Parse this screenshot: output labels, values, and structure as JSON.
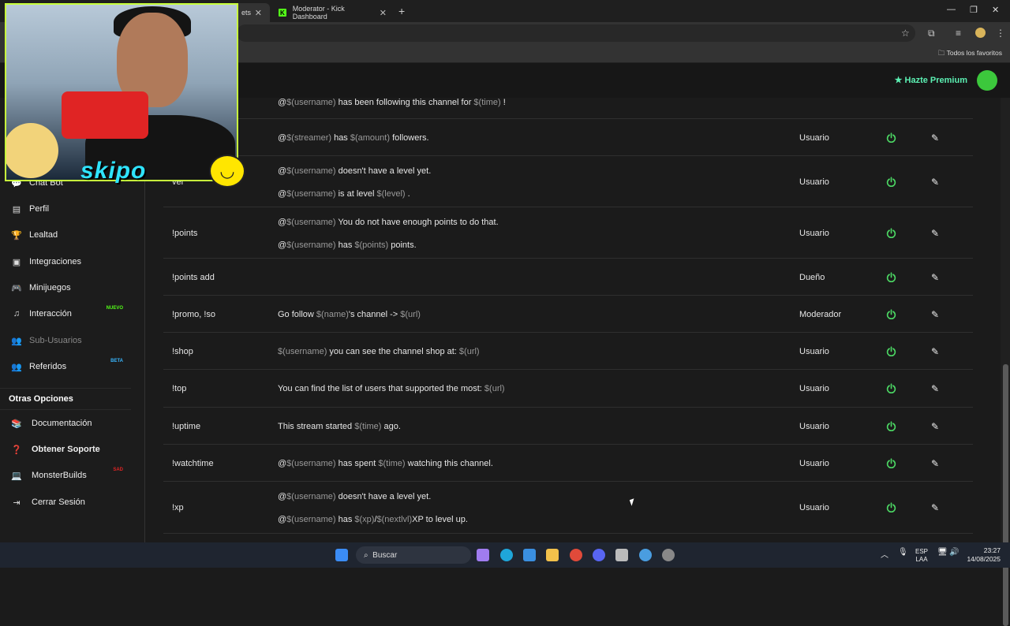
{
  "browser": {
    "tab1_fragment": "ets",
    "tab2_title": "Moderator - Kick Dashboard",
    "new_tab": "+",
    "favorites": "Todos los favoritos"
  },
  "header": {
    "premium": "Hazte Premium"
  },
  "sidebar": {
    "items": [
      {
        "label": "Chat Bot",
        "icon": "chat-icon"
      },
      {
        "label": "Perfil",
        "icon": "id-card-icon"
      },
      {
        "label": "Lealtad",
        "icon": "trophy-icon"
      },
      {
        "label": "Integraciones",
        "icon": "integrations-icon"
      },
      {
        "label": "Minijuegos",
        "icon": "gamepad-icon"
      },
      {
        "label": "Interacción",
        "icon": "music-icon",
        "badge": "NUEVO"
      },
      {
        "label": "Sub-Usuarios",
        "icon": "users-icon"
      },
      {
        "label": "Referidos",
        "icon": "referral-icon",
        "badge": "BETA"
      }
    ],
    "section_title": "Otras Opciones",
    "options": [
      {
        "label": "Documentación",
        "icon": "book-icon"
      },
      {
        "label": "Obtener Soporte",
        "icon": "help-icon"
      },
      {
        "label": "MonsterBuilds",
        "icon": "laptop-icon",
        "badge": "SAD"
      },
      {
        "label": "Cerrar Sesión",
        "icon": "logout-icon"
      }
    ]
  },
  "commands": [
    {
      "name": "",
      "lines": [
        [
          "@",
          "$(username)",
          " has been following this channel for ",
          "$(time)",
          " !"
        ]
      ],
      "role": ""
    },
    {
      "name": "",
      "lines": [
        [
          "@",
          "$(streamer)",
          " has ",
          "$(amount)",
          " followers."
        ]
      ],
      "role": "Usuario"
    },
    {
      "name": "vel",
      "lines": [
        [
          "@",
          "$(username)",
          " doesn't have a level yet."
        ],
        [
          "@",
          "$(username)",
          " is at level ",
          "$(level)",
          " ."
        ]
      ],
      "role": "Usuario"
    },
    {
      "name": "!points",
      "lines": [
        [
          "@",
          "$(username)",
          " You do not have enough points to do that."
        ],
        [
          "@",
          "$(username)",
          " has ",
          "$(points)",
          " points."
        ]
      ],
      "role": "Usuario"
    },
    {
      "name": "!points add",
      "lines": [],
      "role": "Dueño"
    },
    {
      "name": "!promo, !so",
      "lines": [
        [
          "Go follow ",
          "$(name)",
          "'s channel -> ",
          "$(url)",
          ""
        ]
      ],
      "role": "Moderador"
    },
    {
      "name": "!shop",
      "lines": [
        [
          "",
          "$(username)",
          " you can see the channel shop at: ",
          "$(url)",
          ""
        ]
      ],
      "role": "Usuario"
    },
    {
      "name": "!top",
      "lines": [
        [
          "You can find the list of users that supported the most: ",
          "$(url)",
          ""
        ]
      ],
      "role": "Usuario"
    },
    {
      "name": "!uptime",
      "lines": [
        [
          "This stream started ",
          "$(time)",
          " ago."
        ]
      ],
      "role": "Usuario"
    },
    {
      "name": "!watchtime",
      "lines": [
        [
          "@",
          "$(username)",
          " has spent ",
          "$(time)",
          " watching this channel."
        ]
      ],
      "role": "Usuario"
    },
    {
      "name": "!xp",
      "lines": [
        [
          "@",
          "$(username)",
          " doesn't have a level yet."
        ],
        [
          "@",
          "$(username)",
          " has ",
          "$(xp)",
          "/",
          "$(nextlvl)",
          "XP to level up."
        ]
      ],
      "role": "Usuario"
    }
  ],
  "overlay": {
    "name": "skipo"
  },
  "taskbar": {
    "search": "Buscar",
    "lang1": "ESP",
    "lang2": "LAA",
    "time": "23:27",
    "date": "14/08/2025"
  },
  "colors": {
    "accent_green": "#53fc18",
    "premium": "#5cf0b3",
    "power": "#4cd964"
  }
}
